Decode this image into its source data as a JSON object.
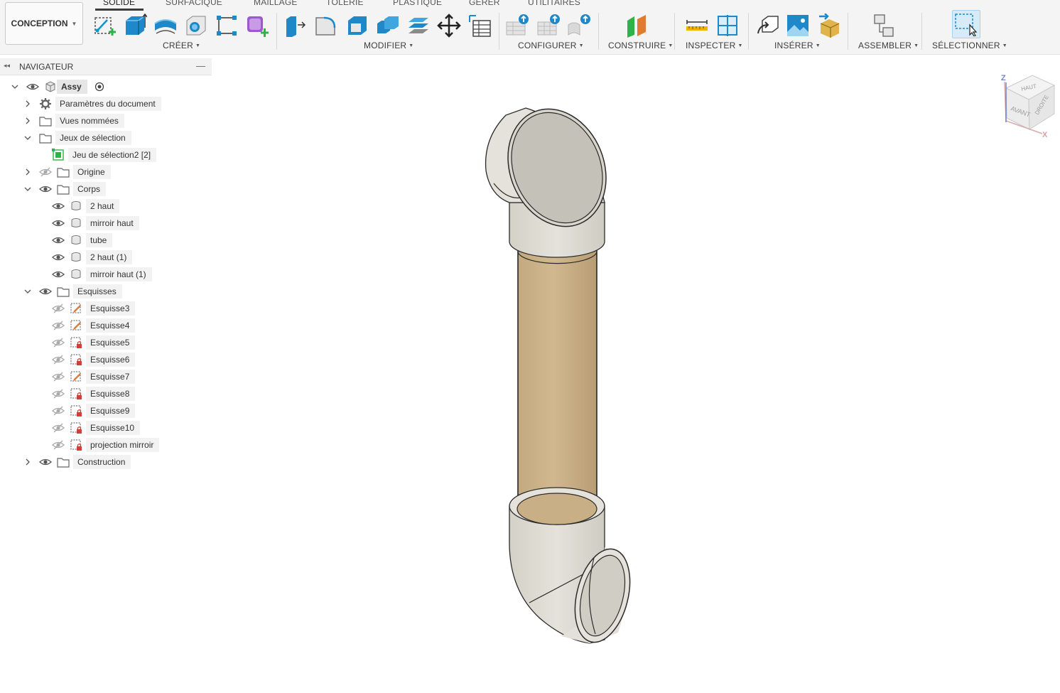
{
  "workspace": {
    "label": "CONCEPTION"
  },
  "tabs": [
    {
      "label": "SOLIDE",
      "active": true
    },
    {
      "label": "SURFACIQUE"
    },
    {
      "label": "MAILLAGE"
    },
    {
      "label": "TÔLERIE"
    },
    {
      "label": "PLASTIQUE"
    },
    {
      "label": "GÉRER"
    },
    {
      "label": "UTILITAIRES"
    }
  ],
  "groups": {
    "creer": "CRÉER",
    "modifier": "MODIFIER",
    "configurer": "CONFIGURER",
    "construire": "CONSTRUIRE",
    "inspecter": "INSPECTER",
    "inserer": "INSÉRER",
    "assembler": "ASSEMBLER",
    "selectionner": "SÉLECTIONNER"
  },
  "navigator": {
    "title": "NAVIGATEUR",
    "root": "Assy",
    "items": [
      {
        "label": "Paramètres du document",
        "icon": "gear-icon"
      },
      {
        "label": "Vues nommées",
        "icon": "folder-icon"
      },
      {
        "label": "Jeux de sélection",
        "icon": "folder-icon"
      },
      {
        "label": "Jeu de sélection2 [2]",
        "icon": "selection-set-icon"
      },
      {
        "label": "Origine",
        "icon": "folder-icon",
        "visible": false
      },
      {
        "label": "Corps",
        "icon": "folder-icon",
        "visible": true
      },
      {
        "label": "2 haut",
        "icon": "body-icon"
      },
      {
        "label": "mirroir haut",
        "icon": "body-icon"
      },
      {
        "label": "tube",
        "icon": "body-icon"
      },
      {
        "label": "2 haut  (1)",
        "icon": "body-icon"
      },
      {
        "label": "mirroir haut (1)",
        "icon": "body-icon"
      },
      {
        "label": "Esquisses",
        "icon": "folder-icon",
        "visible": true
      },
      {
        "label": "Esquisse3",
        "icon": "sketch-icon"
      },
      {
        "label": "Esquisse4",
        "icon": "sketch-icon"
      },
      {
        "label": "Esquisse5",
        "icon": "sketch-locked-icon"
      },
      {
        "label": "Esquisse6",
        "icon": "sketch-locked-icon"
      },
      {
        "label": "Esquisse7",
        "icon": "sketch-icon"
      },
      {
        "label": "Esquisse8",
        "icon": "sketch-locked-icon"
      },
      {
        "label": "Esquisse9",
        "icon": "sketch-locked-icon"
      },
      {
        "label": "Esquisse10",
        "icon": "sketch-locked-icon"
      },
      {
        "label": "projection mirroir",
        "icon": "sketch-locked-icon"
      },
      {
        "label": "Construction",
        "icon": "folder-icon",
        "visible": true
      }
    ]
  },
  "viewcube": {
    "top": "HAUT",
    "front": "AVANT",
    "right": "DROITE",
    "axis_z": "Z",
    "axis_x": "X"
  },
  "colors": {
    "accent": "#0696d7",
    "create_green": "#2db34a",
    "tube": "#c8b088",
    "pipe": "#dedbd2",
    "toolbar_bg": "#f4f4f4"
  }
}
